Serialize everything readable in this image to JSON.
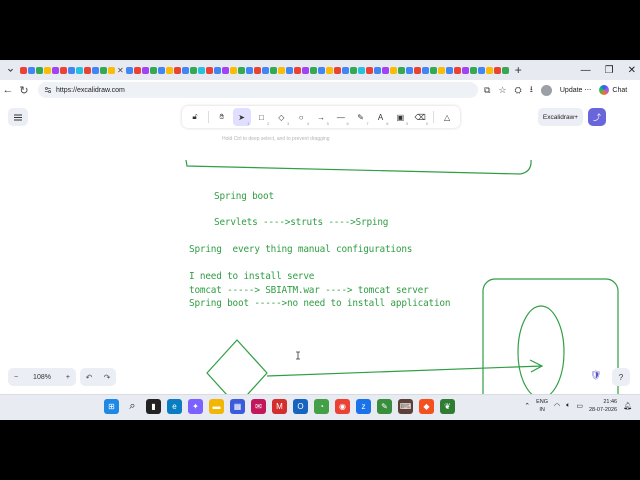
{
  "browser": {
    "url": "https://excalidraw.com",
    "update_label": "Update",
    "chat_label": "Chat",
    "tab_close_glyph": "✕",
    "tab_favicon_colors": [
      "#ea4335",
      "#4285f4",
      "#34a853",
      "#fbbc05",
      "#a142f4",
      "#ea4335",
      "#4285f4",
      "#24c1e0",
      "#ea4335",
      "#4285f4",
      "#34a853",
      "#fbbc05",
      "#4285f4",
      "#ea4335",
      "#a142f4",
      "#34a853",
      "#4285f4",
      "#fbbc05",
      "#ea4335",
      "#4285f4",
      "#34a853",
      "#24c1e0",
      "#ea4335",
      "#4285f4",
      "#a142f4",
      "#fbbc05",
      "#34a853",
      "#4285f4",
      "#ea4335",
      "#4285f4",
      "#34a853",
      "#fbbc05",
      "#4285f4",
      "#ea4335",
      "#a142f4",
      "#34a853",
      "#4285f4",
      "#fbbc05",
      "#ea4335",
      "#4285f4",
      "#34a853",
      "#24c1e0",
      "#ea4335",
      "#4285f4",
      "#a142f4",
      "#fbbc05",
      "#34a853",
      "#4285f4",
      "#ea4335",
      "#4285f4",
      "#34a853",
      "#fbbc05",
      "#4285f4",
      "#ea4335",
      "#a142f4",
      "#34a853",
      "#4285f4",
      "#fbbc05",
      "#ea4335",
      "#34a853"
    ]
  },
  "excalidraw": {
    "library_label": "Excalidraw+",
    "zoom": "108%",
    "hint": "Hold Ctrl to deep select, and to prevent dragging",
    "tool_numbers": [
      "",
      "",
      "1",
      "2",
      "3",
      "4",
      "5",
      "6",
      "7",
      "8",
      "9",
      "0",
      ""
    ],
    "notes": {
      "line1": "Spring boot",
      "line2": "Servlets ---->struts ---->Srping",
      "line3": "Spring  every thing manual configurations",
      "line4": "I need to install serve",
      "line5": "tomcat -----> SBIATM.war ----> tomcat server",
      "line6": "Spring boot ----->no need to install application"
    },
    "stroke_color": "#2f9e44"
  },
  "taskbar": {
    "lang_top": "ENG",
    "lang_bottom": "IN",
    "time": "21:46",
    "date": "28-07-2026"
  }
}
